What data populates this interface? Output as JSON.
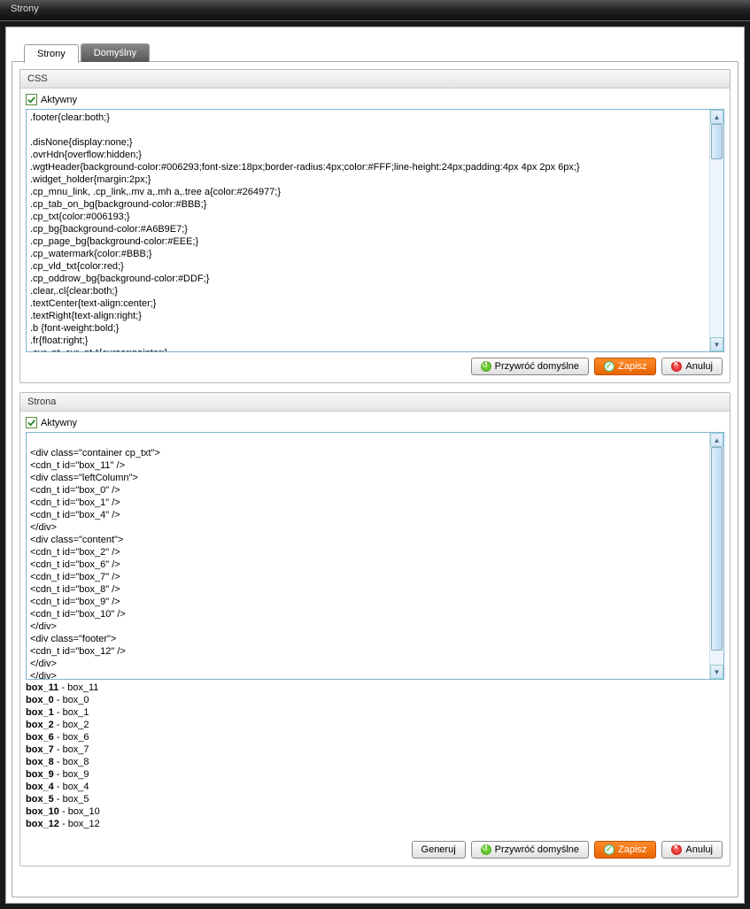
{
  "window": {
    "title": "Strony"
  },
  "tabs": [
    {
      "label": "Strony",
      "active": true
    },
    {
      "label": "Domyślny",
      "active": false
    }
  ],
  "css_section": {
    "title": "CSS",
    "active_label": "Aktywny",
    "active_checked": true,
    "content": ".footer{clear:both;}\n\n.disNone{display:none;}\n.ovrHdn{overflow:hidden;}\n.wgtHeader{background-color:#006293;font-size:18px;border-radius:4px;color:#FFF;line-height:24px;padding:4px 4px 2px 6px;}\n.widget_holder{margin:2px;}\n.cp_mnu_link, .cp_link,.mv a,.mh a,.tree a{color:#264977;}\n.cp_tab_on_bg{background-color:#BBB;}\n.cp_txt{color:#006193;}\n.cp_bg{background-color:#A6B9E7;}\n.cp_page_bg{background-color:#EEE;}\n.cp_watermark{color:#BBB;}\n.cp_vld_txt{color:red;}\n.cp_oddrow_bg{background-color:#DDF;}\n.clear,.cl{clear:both;}\n.textCenter{text-align:center;}\n.textRight{text-align:right;}\n.b {font-weight:bold;}\n.fr{float:right;}\n.cur_pt,.cur_pt *{cursor:pointer;}"
  },
  "strona_section": {
    "title": "Strona",
    "active_label": "Aktywny",
    "active_checked": true,
    "content": "\n<div class=\"container cp_txt\">\n<cdn_t id=\"box_11\" />\n<div class=\"leftColumn\">\n<cdn_t id=\"box_0\" />\n<cdn_t id=\"box_1\" />\n<cdn_t id=\"box_4\" />\n</div>\n<div class=\"content\">\n<cdn_t id=\"box_2\" />\n<cdn_t id=\"box_6\" />\n<cdn_t id=\"box_7\" />\n<cdn_t id=\"box_8\" />\n<cdn_t id=\"box_9\" />\n<cdn_t id=\"box_10\" />\n</div>\n<div class=\"footer\">\n<cdn_t id=\"box_12\" />\n</div>\n</div>"
  },
  "boxes": [
    {
      "id": "box_11",
      "name": "box_11"
    },
    {
      "id": "box_0",
      "name": "box_0"
    },
    {
      "id": "box_1",
      "name": "box_1"
    },
    {
      "id": "box_2",
      "name": "box_2"
    },
    {
      "id": "box_6",
      "name": "box_6"
    },
    {
      "id": "box_7",
      "name": "box_7"
    },
    {
      "id": "box_8",
      "name": "box_8"
    },
    {
      "id": "box_9",
      "name": "box_9"
    },
    {
      "id": "box_4",
      "name": "box_4"
    },
    {
      "id": "box_5",
      "name": "box_5"
    },
    {
      "id": "box_10",
      "name": "box_10"
    },
    {
      "id": "box_12",
      "name": "box_12"
    }
  ],
  "buttons": {
    "restore": "Przywróć domyślne",
    "save": "Zapisz",
    "cancel": "Anuluj",
    "generate": "Generuj"
  }
}
